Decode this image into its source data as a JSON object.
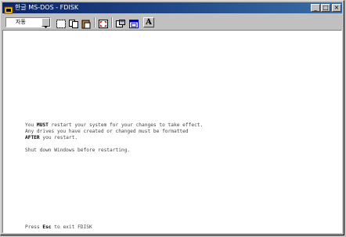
{
  "window": {
    "title": "한글 MS-DOS - FDISK",
    "controls": {
      "minimize": "_",
      "maximize": "□",
      "close": "×"
    }
  },
  "toolbar": {
    "font_size_value": "자동",
    "font_button_label": "A",
    "icons": [
      "dropdown-arrow-icon",
      "mark-icon",
      "copy-icon",
      "paste-icon",
      "fullscreen-icon",
      "properties-icon",
      "background-icon",
      "font-icon"
    ]
  },
  "console": {
    "line1": {
      "pre": "You ",
      "bold": "MUST",
      "post": " restart your system for your changes to take effect."
    },
    "line2": {
      "text": "Any drives you have created or changed must be formatted"
    },
    "line3": {
      "bold": "AFTER",
      "post": " you restart."
    },
    "line4": {
      "text": "Shut down Windows before restarting."
    },
    "footer": {
      "pre": "Press ",
      "bold": "Esc",
      "post": " to exit FDISK"
    }
  },
  "colors": {
    "titlebar_start": "#0a246a",
    "titlebar_end": "#3a6ea5",
    "chrome": "#c0c0c0",
    "console_bg": "#ffffff",
    "console_text": "#444444"
  }
}
